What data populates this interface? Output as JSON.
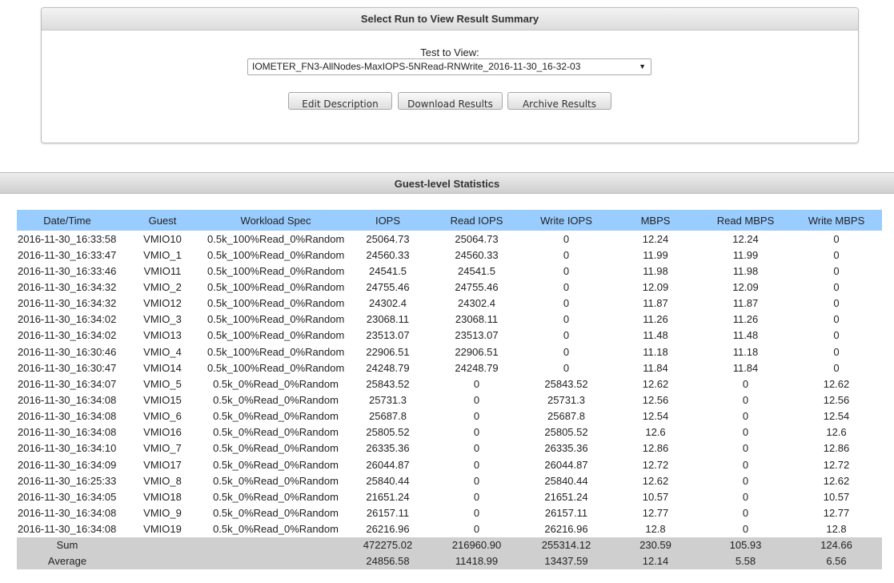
{
  "select_panel": {
    "title": "Select Run to View Result Summary",
    "test_label": "Test to View:",
    "selected_test": "IOMETER_FN3-AllNodes-MaxIOPS-5NRead-RNWrite_2016-11-30_16-32-03",
    "buttons": {
      "edit": "Edit Description",
      "download": "Download Results",
      "archive": "Archive Results"
    }
  },
  "stats": {
    "title": "Guest-level Statistics",
    "columns": [
      "Date/Time",
      "Guest",
      "Workload Spec",
      "IOPS",
      "Read IOPS",
      "Write IOPS",
      "MBPS",
      "Read MBPS",
      "Write MBPS"
    ],
    "rows": [
      [
        "2016-11-30_16:33:58",
        "VMIO10",
        "0.5k_100%Read_0%Random",
        "25064.73",
        "25064.73",
        "0",
        "12.24",
        "12.24",
        "0"
      ],
      [
        "2016-11-30_16:33:47",
        "VMIO_1",
        "0.5k_100%Read_0%Random",
        "24560.33",
        "24560.33",
        "0",
        "11.99",
        "11.99",
        "0"
      ],
      [
        "2016-11-30_16:33:46",
        "VMIO11",
        "0.5k_100%Read_0%Random",
        "24541.5",
        "24541.5",
        "0",
        "11.98",
        "11.98",
        "0"
      ],
      [
        "2016-11-30_16:34:32",
        "VMIO_2",
        "0.5k_100%Read_0%Random",
        "24755.46",
        "24755.46",
        "0",
        "12.09",
        "12.09",
        "0"
      ],
      [
        "2016-11-30_16:34:32",
        "VMIO12",
        "0.5k_100%Read_0%Random",
        "24302.4",
        "24302.4",
        "0",
        "11.87",
        "11.87",
        "0"
      ],
      [
        "2016-11-30_16:34:02",
        "VMIO_3",
        "0.5k_100%Read_0%Random",
        "23068.11",
        "23068.11",
        "0",
        "11.26",
        "11.26",
        "0"
      ],
      [
        "2016-11-30_16:34:02",
        "VMIO13",
        "0.5k_100%Read_0%Random",
        "23513.07",
        "23513.07",
        "0",
        "11.48",
        "11.48",
        "0"
      ],
      [
        "2016-11-30_16:30:46",
        "VMIO_4",
        "0.5k_100%Read_0%Random",
        "22906.51",
        "22906.51",
        "0",
        "11.18",
        "11.18",
        "0"
      ],
      [
        "2016-11-30_16:30:47",
        "VMIO14",
        "0.5k_100%Read_0%Random",
        "24248.79",
        "24248.79",
        "0",
        "11.84",
        "11.84",
        "0"
      ],
      [
        "2016-11-30_16:34:07",
        "VMIO_5",
        "0.5k_0%Read_0%Random",
        "25843.52",
        "0",
        "25843.52",
        "12.62",
        "0",
        "12.62"
      ],
      [
        "2016-11-30_16:34:08",
        "VMIO15",
        "0.5k_0%Read_0%Random",
        "25731.3",
        "0",
        "25731.3",
        "12.56",
        "0",
        "12.56"
      ],
      [
        "2016-11-30_16:34:08",
        "VMIO_6",
        "0.5k_0%Read_0%Random",
        "25687.8",
        "0",
        "25687.8",
        "12.54",
        "0",
        "12.54"
      ],
      [
        "2016-11-30_16:34:08",
        "VMIO16",
        "0.5k_0%Read_0%Random",
        "25805.52",
        "0",
        "25805.52",
        "12.6",
        "0",
        "12.6"
      ],
      [
        "2016-11-30_16:34:10",
        "VMIO_7",
        "0.5k_0%Read_0%Random",
        "26335.36",
        "0",
        "26335.36",
        "12.86",
        "0",
        "12.86"
      ],
      [
        "2016-11-30_16:34:09",
        "VMIO17",
        "0.5k_0%Read_0%Random",
        "26044.87",
        "0",
        "26044.87",
        "12.72",
        "0",
        "12.72"
      ],
      [
        "2016-11-30_16:25:33",
        "VMIO_8",
        "0.5k_0%Read_0%Random",
        "25840.44",
        "0",
        "25840.44",
        "12.62",
        "0",
        "12.62"
      ],
      [
        "2016-11-30_16:34:05",
        "VMIO18",
        "0.5k_0%Read_0%Random",
        "21651.24",
        "0",
        "21651.24",
        "10.57",
        "0",
        "10.57"
      ],
      [
        "2016-11-30_16:34:08",
        "VMIO_9",
        "0.5k_0%Read_0%Random",
        "26157.11",
        "0",
        "26157.11",
        "12.77",
        "0",
        "12.77"
      ],
      [
        "2016-11-30_16:34:08",
        "VMIO19",
        "0.5k_0%Read_0%Random",
        "26216.96",
        "0",
        "26216.96",
        "12.8",
        "0",
        "12.8"
      ]
    ],
    "totals": [
      [
        "Sum",
        "",
        "",
        "472275.02",
        "216960.90",
        "255314.12",
        "230.59",
        "105.93",
        "124.66"
      ],
      [
        "Average",
        "",
        "",
        "24856.58",
        "11418.99",
        "13437.59",
        "12.14",
        "5.58",
        "6.56"
      ]
    ]
  }
}
